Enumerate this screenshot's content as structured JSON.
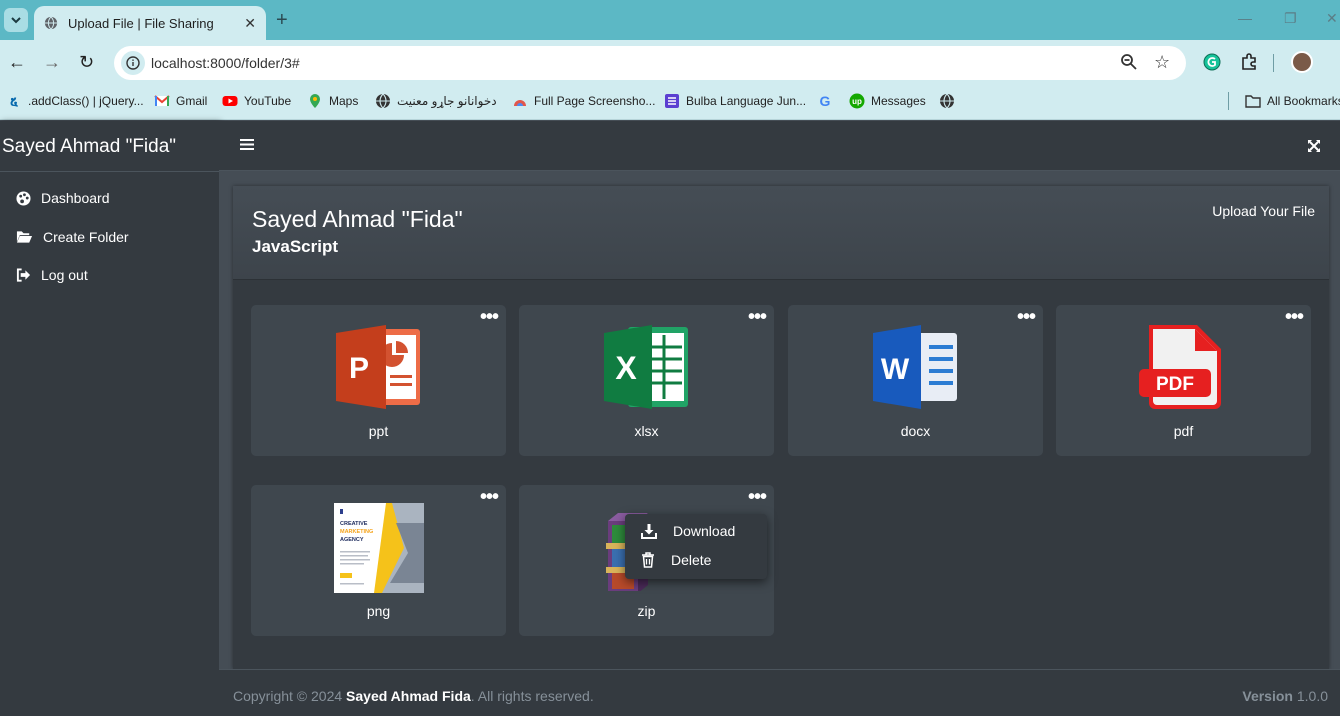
{
  "browser": {
    "tab_title": "Upload File | File Sharing",
    "url": "localhost:8000/folder/3#",
    "bookmarks": [
      {
        "label": ".addClass() | jQuery...",
        "icon": "jquery-icon"
      },
      {
        "label": "Gmail",
        "icon": "gmail-icon"
      },
      {
        "label": "YouTube",
        "icon": "youtube-icon"
      },
      {
        "label": "Maps",
        "icon": "maps-icon"
      },
      {
        "label": "دخوانانو جاړو معنیت",
        "icon": "globe-icon"
      },
      {
        "label": "Full Page Screensho...",
        "icon": "screenshot-icon"
      },
      {
        "label": "Bulba Language Jun...",
        "icon": "bulba-icon"
      },
      {
        "label": "",
        "icon": "google-icon"
      },
      {
        "label": "Messages",
        "icon": "upwork-icon"
      },
      {
        "label": "",
        "icon": "globe-icon"
      }
    ],
    "all_bookmarks": "All Bookmarks"
  },
  "app": {
    "brand": "Sayed Ahmad \"Fida\"",
    "sidebar": {
      "items": [
        {
          "label": "Dashboard",
          "icon": "palette-icon"
        },
        {
          "label": "Create Folder",
          "icon": "folder-open-icon"
        },
        {
          "label": "Log out",
          "icon": "sign-out-icon"
        }
      ]
    },
    "header": {
      "owner": "Sayed Ahmad \"Fida\"",
      "folder": "JavaScript",
      "upload_label": "Upload Your File"
    },
    "files": [
      {
        "name": "ppt",
        "icon": "powerpoint-icon"
      },
      {
        "name": "xlsx",
        "icon": "excel-icon"
      },
      {
        "name": "docx",
        "icon": "word-icon"
      },
      {
        "name": "pdf",
        "icon": "pdf-icon"
      },
      {
        "name": "png",
        "icon": "image-thumbnail"
      },
      {
        "name": "zip",
        "icon": "winrar-icon"
      }
    ],
    "thumbnail_text": {
      "line1": "CREATIVE",
      "line2": "MARKETING",
      "line3": "AGENCY"
    },
    "context_menu": {
      "download": "Download",
      "delete": "Delete"
    },
    "footer": {
      "copyright_prefix": "Copyright © 2024 ",
      "author": "Sayed Ahmad Fida",
      "copyright_suffix": ". All rights reserved.",
      "version_label": "Version",
      "version_value": " 1.0.0"
    }
  },
  "colors": {
    "sidebar_bg": "#343a40",
    "content_bg": "#454d55",
    "chrome_accent": "#5cb8c5",
    "toolbar_bg": "#d1ecf0"
  }
}
